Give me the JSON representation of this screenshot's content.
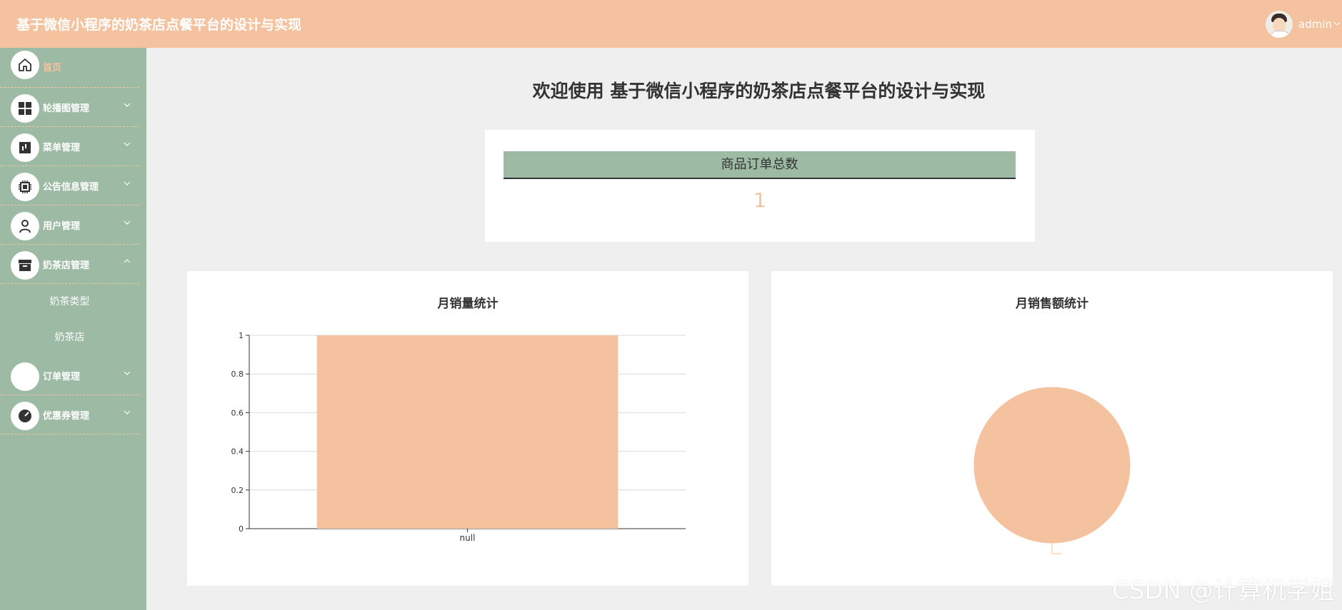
{
  "header": {
    "title": "基于微信小程序的奶茶店点餐平台的设计与实现",
    "user_name": "admin",
    "user_chevron_icon": "chevron-down-icon"
  },
  "sidebar": {
    "items": [
      {
        "label": "首页",
        "icon": "home-icon",
        "active": true
      },
      {
        "label": "轮播图管理",
        "icon": "grid-icon"
      },
      {
        "label": "菜单管理",
        "icon": "menu-doc-icon"
      },
      {
        "label": "公告信息管理",
        "icon": "chip-icon"
      },
      {
        "label": "用户管理",
        "icon": "user-icon"
      },
      {
        "label": "奶茶店管理",
        "icon": "archive-icon",
        "expanded": true,
        "children": [
          "奶茶类型",
          "奶茶店"
        ]
      },
      {
        "label": "订单管理",
        "icon": "blank-icon"
      },
      {
        "label": "优惠券管理",
        "icon": "gauge-icon"
      }
    ]
  },
  "main": {
    "welcome": "欢迎使用 基于微信小程序的奶茶店点餐平台的设计与实现",
    "stat_card": {
      "label": "商品订单总数",
      "value": "1"
    }
  },
  "chart_data": [
    {
      "type": "bar",
      "title": "月销量统计",
      "categories": [
        "null"
      ],
      "values": [
        1
      ],
      "ylim": [
        0,
        1
      ],
      "yticks": [
        "0",
        "0.2",
        "0.4",
        "0.6",
        "0.8",
        "1"
      ],
      "grid": true,
      "color": "#f4c29e"
    },
    {
      "type": "pie",
      "title": "月销售额统计",
      "slices": [
        {
          "label": "",
          "value": 1
        }
      ],
      "color": "#f4c29e"
    }
  ],
  "colors": {
    "accent": "#f4c29e",
    "sidebar": "#9dbaa4",
    "background": "#efefef"
  },
  "watermark": "CSDN @计算机学姐"
}
